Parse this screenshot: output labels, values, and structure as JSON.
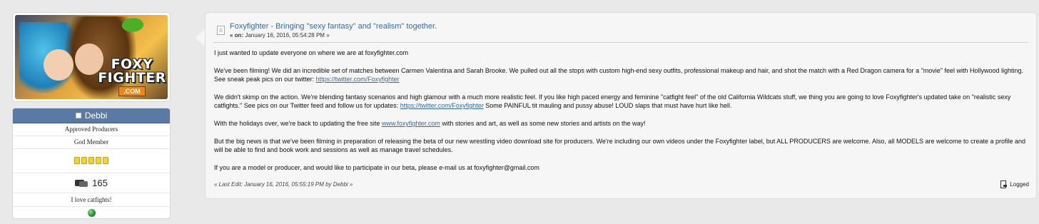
{
  "poster": {
    "avatar_alt": "Foxyfighter avatar",
    "logo_line1": "FOXY",
    "logo_line2": "FIGHTER",
    "logo_dotcom": ".COM",
    "name": "Debbi",
    "group": "Approved Producers",
    "rank": "God Member",
    "stars": 5,
    "post_count": "165",
    "personal_text": "I love catfights!"
  },
  "post": {
    "title": "Foxyfighter - Bringing \"sexy fantasy\" and \"realism\" together.",
    "date_prefix": "« on:",
    "date_value": " January 16, 2016, 05:54:28 PM »",
    "p1": "I just wanted to update everyone on where we are at foxyfighter.com",
    "p2_text": "We've been filming! We did an incredible set of matches between Carmen Valentina and Sarah Brooke. We pulled out all the stops with custom high-end sexy outfits, professional makeup and hair, and shot the match with a Red Dragon camera for a \"movie\" feel with Hollywood lighting. See sneak peak pics on our twitter: ",
    "p2_link": "https://twitter.com/Foxyfighter",
    "p3_text_a": "We didn't skimp on the action. We're blending fantasy scenarios and high glamour with a much more realistic feel. If you like high paced energy and feminine \"catfight feel\" of the old California Wildcats stuff, we thing you are going to love Foxyfighter's updated take on \"realistic sexy catfights.\" See pics on our Twitter feed and follow us for updates: ",
    "p3_link": "https://twitter.com/Foxyfighter",
    "p3_text_b": " Some PAINFUL tit mauling and pussy abuse! LOUD slaps that must have hurt like hell.",
    "p4_text_a": "With the holidays over, we're back to updating the free site ",
    "p4_link": "www.foxyfighter.com",
    "p4_text_b": " with stories and art, as well as some new stories and artists on the way!",
    "p5": "But the big news is that we've been filming in preparation of releasing the beta of our new wrestling video download site for producers. We're including our own videos under the Foxyfighter label, but ALL PRODUCERS are welcome. Also, all MODELS are welcome to create a profile and will be able to find and book work and sessions as well as manage travel schedules.",
    "p6": "If you are a model or producer, and would like to participate in our beta, please e-mail us at foxyfighter@gmail.com",
    "last_edit": "« Last Edit: January 16, 2016, 05:55:19 PM by Debbi »",
    "logged_label": "Logged"
  }
}
